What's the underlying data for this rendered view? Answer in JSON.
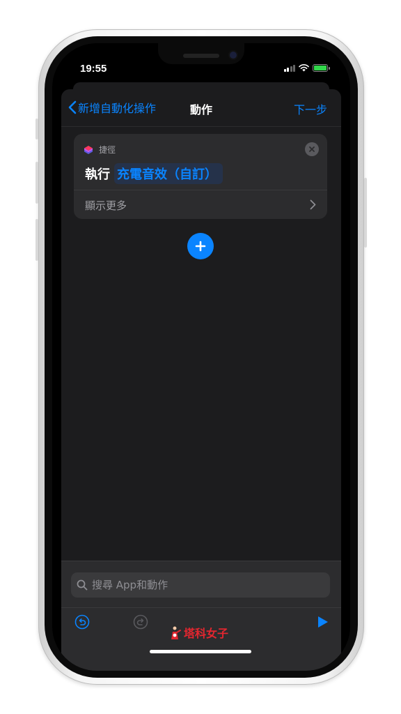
{
  "status_bar": {
    "time": "19:55"
  },
  "nav": {
    "back_label": "新增自動化操作",
    "title": "動作",
    "next_label": "下一步"
  },
  "action_card": {
    "app_name": "捷徑",
    "verb": "執行",
    "parameter": "充電音效（自訂）",
    "show_more_label": "顯示更多"
  },
  "search": {
    "placeholder": "搜尋 App和動作"
  },
  "watermark": {
    "text": "塔科女子"
  },
  "colors": {
    "accent": "#0a84ff",
    "sheet_bg": "#1c1c1e",
    "card_bg": "#2c2c2e",
    "battery": "#32d74b",
    "watermark": "#e3262f"
  },
  "icons": {
    "back": "chevron-left-icon",
    "app": "shortcuts-app-icon",
    "close": "close-circle-icon",
    "more": "chevron-right-icon",
    "add": "plus-icon",
    "search": "magnifier-icon",
    "undo": "undo-icon",
    "redo": "redo-icon",
    "play": "play-icon"
  }
}
